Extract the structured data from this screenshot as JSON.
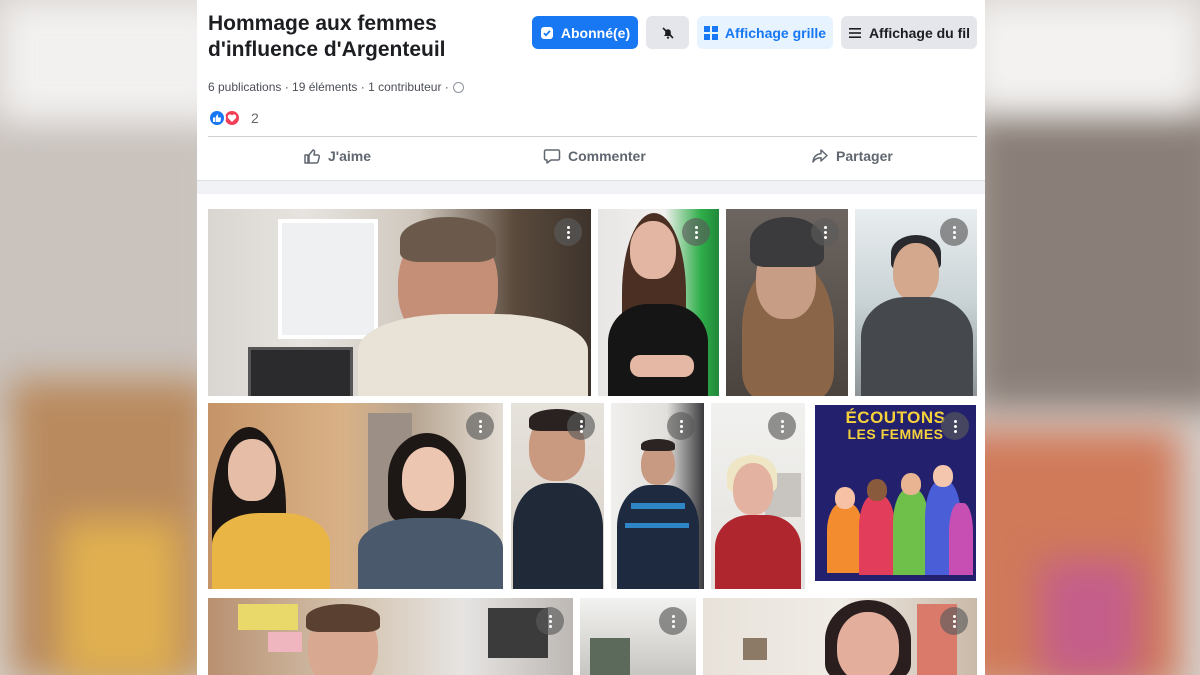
{
  "album": {
    "title": "Hommage aux femmes d'influence d'Argenteuil",
    "subscribed_label": "Abonné(e)",
    "grid_view_label": "Affichage grille",
    "feed_view_label": "Affichage du fil",
    "meta": "6 publications · 19 éléments · 1 contributeur ·",
    "reaction_count": "2"
  },
  "actions": {
    "like": "J'aime",
    "comment": "Commenter",
    "share": "Partager"
  },
  "poster": {
    "title_line1": "ÉCOUTONS",
    "title_line2": "LES FEMMES"
  },
  "colors": {
    "brand_blue": "#1877f2",
    "love_red": "#f33e58"
  }
}
